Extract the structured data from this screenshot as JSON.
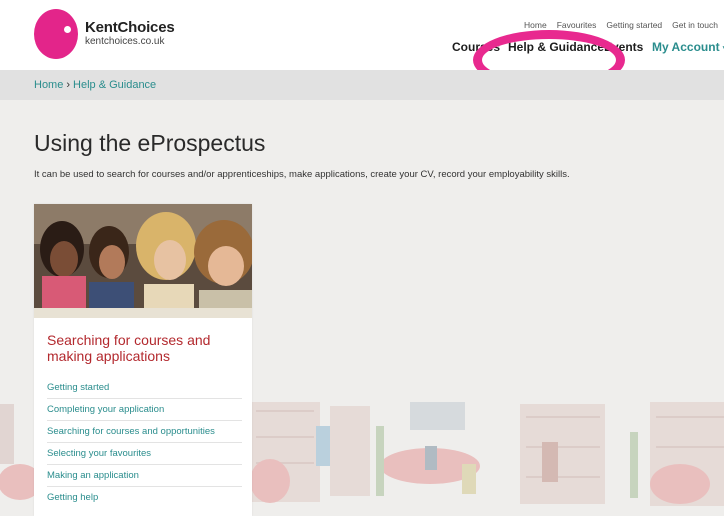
{
  "brand": {
    "name": "KentChoices",
    "url": "kentchoices.co.uk"
  },
  "top_links": [
    "Home",
    "Favourites",
    "Getting started",
    "Get in touch"
  ],
  "main_nav": {
    "courses": "Courses",
    "help": "Help & Guidance",
    "events": "Events",
    "account": "My Account",
    "account_caret": "▾"
  },
  "breadcrumb": {
    "home": "Home",
    "separator": "›",
    "current": "Help & Guidance"
  },
  "page": {
    "title": "Using the eProspectus",
    "description": "It can be used to search for courses and/or apprenticeships, make applications, create your CV, record your employability skills."
  },
  "card": {
    "title": "Searching for courses and making applications",
    "links": [
      "Getting started",
      "Completing your application",
      "Searching for courses and opportunities",
      "Selecting your favourites",
      "Making an application",
      "Getting help"
    ]
  },
  "colors": {
    "brand_pink": "#e3258a",
    "teal_link": "#2a8d8d",
    "card_title_red": "#b3292e"
  },
  "icons": {
    "highlight": "highlight-ring",
    "logo": "logo-circle"
  }
}
